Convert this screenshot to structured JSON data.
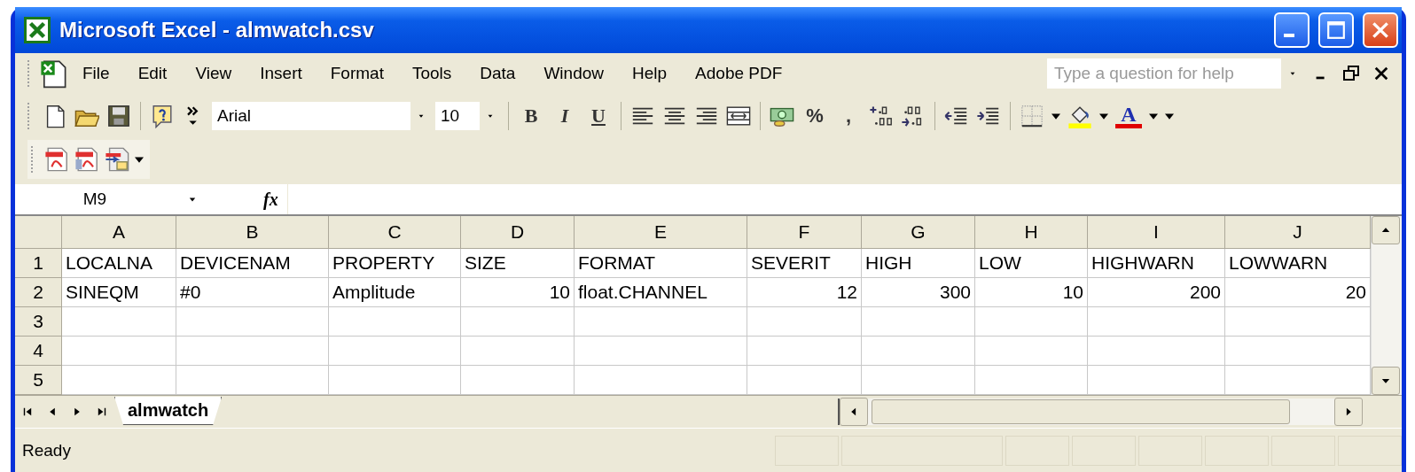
{
  "window": {
    "title": "Microsoft Excel - almwatch.csv"
  },
  "menu": [
    {
      "label": "File"
    },
    {
      "label": "Edit"
    },
    {
      "label": "View"
    },
    {
      "label": "Insert"
    },
    {
      "label": "Format"
    },
    {
      "label": "Tools"
    },
    {
      "label": "Data"
    },
    {
      "label": "Window"
    },
    {
      "label": "Help"
    },
    {
      "label": "Adobe PDF"
    }
  ],
  "help_box": {
    "placeholder": "Type a question for help"
  },
  "toolbar": [
    {
      "kind": "new"
    },
    {
      "kind": "open"
    },
    {
      "kind": "save"
    },
    {
      "kind": "separator"
    },
    {
      "kind": "help"
    },
    {
      "kind": "more"
    },
    {
      "kind": "font",
      "value": "Arial"
    },
    {
      "kind": "size",
      "value": "10"
    },
    {
      "kind": "separator"
    },
    {
      "kind": "bold",
      "label": "B"
    },
    {
      "kind": "italic",
      "label": "I"
    },
    {
      "kind": "underline",
      "label": "U"
    },
    {
      "kind": "separator"
    },
    {
      "kind": "align-left"
    },
    {
      "kind": "align-center"
    },
    {
      "kind": "align-right"
    },
    {
      "kind": "merge"
    },
    {
      "kind": "separator"
    },
    {
      "kind": "currency"
    },
    {
      "kind": "text",
      "label": "%"
    },
    {
      "kind": "text",
      "label": ","
    },
    {
      "kind": "inc-decimal"
    },
    {
      "kind": "dec-decimal"
    },
    {
      "kind": "separator"
    },
    {
      "kind": "outdent"
    },
    {
      "kind": "indent"
    },
    {
      "kind": "separator"
    },
    {
      "kind": "borders"
    },
    {
      "kind": "caret"
    },
    {
      "kind": "fill"
    },
    {
      "kind": "caret"
    },
    {
      "kind": "font-color",
      "label": "A"
    },
    {
      "kind": "caret"
    },
    {
      "kind": "caret"
    }
  ],
  "pdf_toolbar": [
    {
      "kind": "pdf"
    },
    {
      "kind": "pdf-doc"
    },
    {
      "kind": "pdf-mail"
    },
    {
      "kind": "caret"
    }
  ],
  "formula_bar": {
    "name_box": "M9",
    "fx": "fx"
  },
  "table": {
    "columns": [
      "A",
      "B",
      "C",
      "D",
      "E",
      "F",
      "G",
      "H",
      "I",
      "J"
    ],
    "rows": [
      {
        "number": "1",
        "cells": [
          {
            "text": "LOCALNA",
            "kind": "text"
          },
          {
            "text": "DEVICENAM",
            "kind": "text"
          },
          {
            "text": "PROPERTY",
            "kind": "text"
          },
          {
            "text": "SIZE",
            "kind": "text"
          },
          {
            "text": "FORMAT",
            "kind": "text"
          },
          {
            "text": "SEVERIT",
            "kind": "text"
          },
          {
            "text": "HIGH",
            "kind": "text"
          },
          {
            "text": "LOW",
            "kind": "text"
          },
          {
            "text": "HIGHWARN",
            "kind": "text"
          },
          {
            "text": "LOWWARN",
            "kind": "text"
          }
        ]
      },
      {
        "number": "2",
        "cells": [
          {
            "text": "SINEQM",
            "kind": "text"
          },
          {
            "text": "#0",
            "kind": "text"
          },
          {
            "text": "Amplitude",
            "kind": "text"
          },
          {
            "text": "10",
            "kind": "number"
          },
          {
            "text": "float.CHANNEL",
            "kind": "text"
          },
          {
            "text": "12",
            "kind": "number"
          },
          {
            "text": "300",
            "kind": "number"
          },
          {
            "text": "10",
            "kind": "number"
          },
          {
            "text": "200",
            "kind": "number"
          },
          {
            "text": "20",
            "kind": "number"
          }
        ]
      },
      {
        "number": "3"
      },
      {
        "number": "4"
      },
      {
        "number": "5"
      }
    ]
  },
  "sheet_tabs": [
    {
      "label": "almwatch",
      "selected": true
    }
  ],
  "status_bar": {
    "text": "Ready"
  }
}
